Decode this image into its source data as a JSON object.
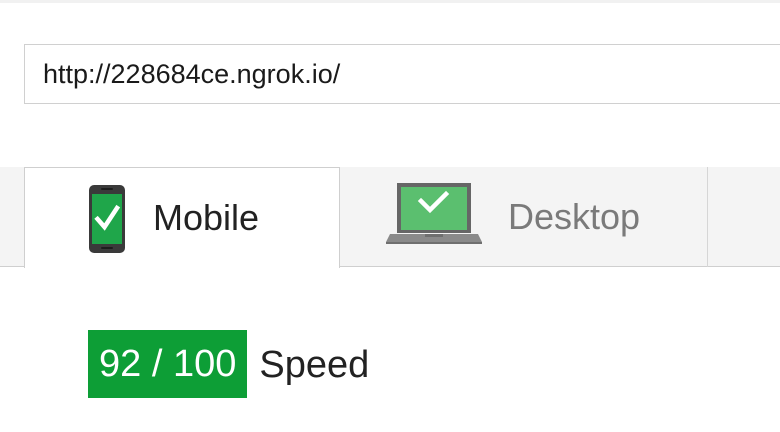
{
  "url_field": {
    "value": "http://228684ce.ngrok.io/"
  },
  "tabs": [
    {
      "label": "Mobile",
      "icon": "mobile-phone-check-icon",
      "selected": true
    },
    {
      "label": "Desktop",
      "icon": "laptop-check-icon",
      "selected": false
    }
  ],
  "score": {
    "badge": "92 / 100",
    "label": "Speed"
  },
  "colors": {
    "score_badge": "#0d9e36",
    "icon_screen": "#1fa64a",
    "laptop_screen": "#5bbf6f",
    "tab_strip": "#f4f4f4"
  }
}
